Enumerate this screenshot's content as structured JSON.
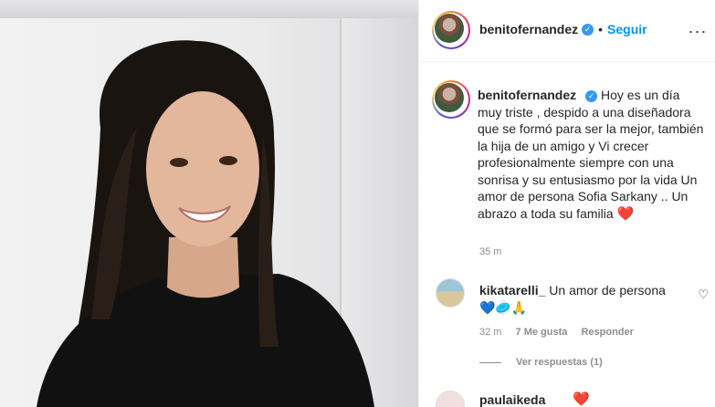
{
  "post": {
    "author": "benitofernandez",
    "verified_mark": "✓",
    "dot": "•",
    "follow_label": "Seguir",
    "more_label": "···"
  },
  "caption": {
    "author": "benitofernandez",
    "text": "Hoy es un día muy triste , despido a una diseñadora que se formó para ser la mejor, también la hija de un amigo y Vi crecer profesionalmente siempre con una sonrisa y su entusiasmo por la vida Un amor de persona Sofia Sarkany .. Un abrazo a toda su familia",
    "emoji": "❤️",
    "time": "35 m"
  },
  "comments": [
    {
      "author": "kikatarelli_",
      "text": "Un amor de persona",
      "emoji": "💙🥏🙏",
      "time": "32 m",
      "likes": "7 Me gusta",
      "reply_label": "Responder",
      "like_icon": "♡"
    }
  ],
  "view_replies_label": "Ver respuestas (1)",
  "comment2": {
    "author": "paulaikeda",
    "emoji": "❤️"
  },
  "colors": {
    "link_blue": "#0095f6",
    "verified_blue": "#3897f0",
    "heart_red": "#ed4956",
    "muted": "#8e8e8e"
  }
}
